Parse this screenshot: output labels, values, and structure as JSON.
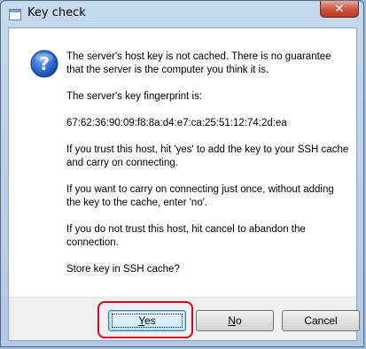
{
  "window": {
    "title": "Key check",
    "close_glyph": "✕"
  },
  "message": {
    "p1": "The server's host key is not cached. There is no guarantee that the server is the computer you think it is.",
    "p2": "The server's key fingerprint is:",
    "p3": "67:62:36:90:09:f8:8a:d4:e7:ca:25:51:12:74:2d:ea",
    "p4": "If you trust this host, hit 'yes' to add the key to your SSH cache and carry on connecting.",
    "p5": "If you want to carry on connecting just once, without adding the key to the cache, enter 'no'.",
    "p6": "If you do not trust this host, hit cancel to abandon the connection.",
    "p7": "Store key in SSH cache?"
  },
  "buttons": {
    "yes_rest": "es",
    "yes_mnemonic": "Y",
    "no_rest": "o",
    "no_mnemonic": "N",
    "cancel": "Cancel"
  },
  "icons": {
    "question": "question-icon"
  },
  "colors": {
    "highlight": "#d4001e",
    "icon_blue": "#1f5fbf"
  }
}
